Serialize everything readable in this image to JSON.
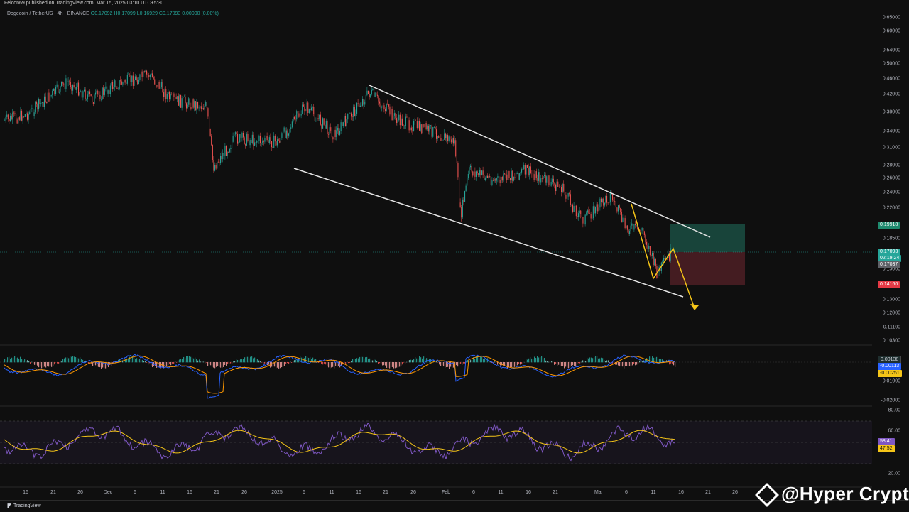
{
  "header": {
    "published": "Felcon69 published on TradingView.com, Mar 15, 2025 03:10 UTC+5:30",
    "symbol": "Dogecoin / TetherUS · 4h · BINANCE",
    "ohlc": "O0.17092 H0.17099 L0.16929 C0.17093 0.00000 (0.00%)"
  },
  "price_axis": {
    "ticks": [
      "0.65000",
      "0.60000",
      "0.54000",
      "0.50000",
      "0.46000",
      "0.42000",
      "0.38000",
      "0.34000",
      "0.31000",
      "0.28000",
      "0.26000",
      "0.24000",
      "0.22000",
      "0.18500",
      "0.15000",
      "0.13000",
      "0.12000",
      "0.11100",
      "0.10300"
    ],
    "badges": {
      "target": "0.19918",
      "last": "0.17093",
      "countdown": "02:19:24",
      "entry": "0.17037",
      "stop": "0.14160"
    }
  },
  "macd_axis": {
    "ticks": [
      "-0.01000",
      "-0.02000"
    ],
    "badges": {
      "hist": "0.00138",
      "macd": "-0.00113",
      "signal": "-0.00251"
    }
  },
  "rsi_axis": {
    "ticks": [
      "80.00",
      "60.00",
      "20.00"
    ],
    "badges": {
      "rsi": "58.41",
      "ma": "47.52"
    }
  },
  "time_axis": {
    "ticks": [
      "16",
      "21",
      "26",
      "Dec",
      "6",
      "11",
      "16",
      "21",
      "26",
      "2025",
      "6",
      "11",
      "16",
      "21",
      "26",
      "Feb",
      "6",
      "11",
      "16",
      "21",
      "Mar",
      "6",
      "11",
      "16",
      "21",
      "26"
    ]
  },
  "footer": {
    "brand": "TradingView"
  },
  "watermark": "@Hyper Crypto",
  "colors": {
    "up": "#26a69a",
    "down": "#ef5350",
    "trendline": "#e6e6e6",
    "projection": "#f5c518",
    "target_zone": "#1a4a3f",
    "stop_zone": "#4a1e24",
    "macd": "#2962ff",
    "signal": "#ff9800",
    "rsi": "#7e57c2",
    "rsi_ma": "#f5c518"
  }
}
